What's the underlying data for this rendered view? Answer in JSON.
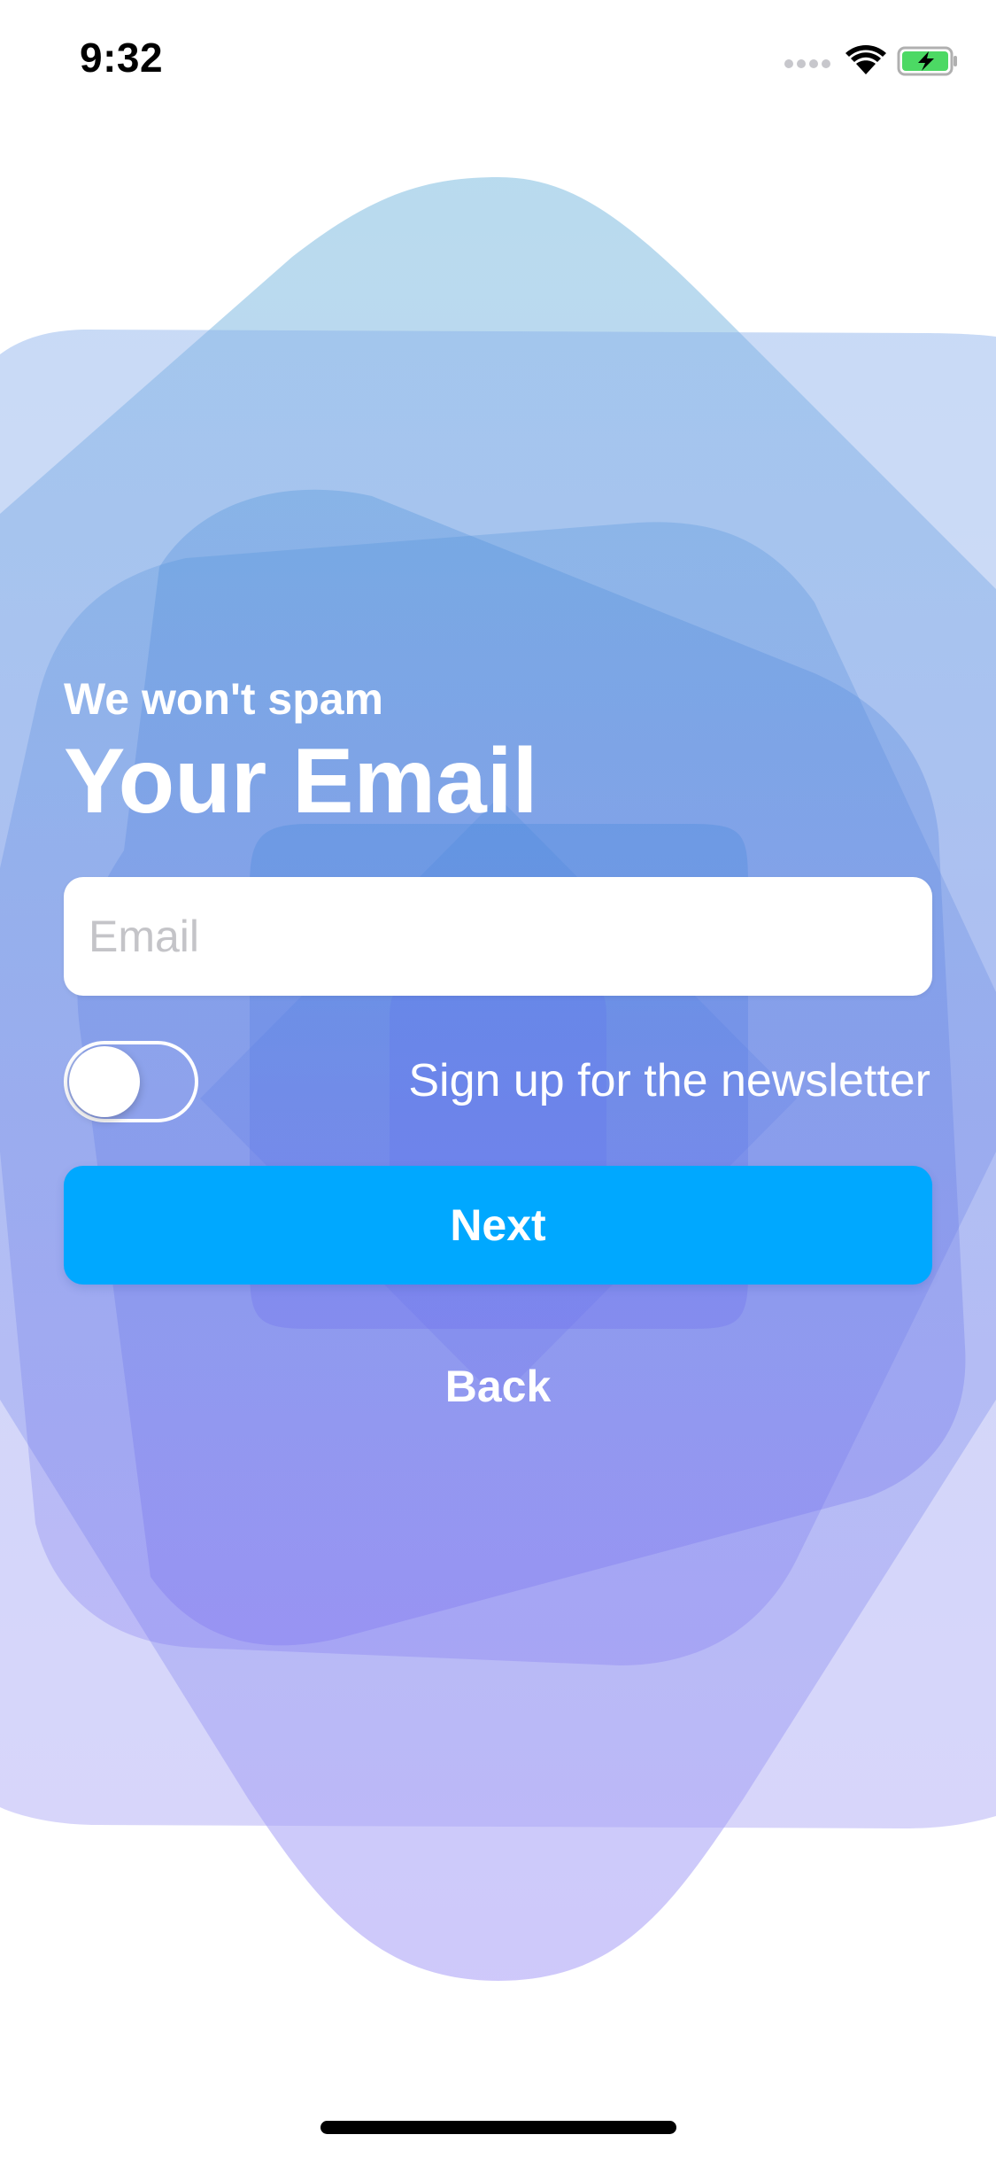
{
  "status_bar": {
    "time": "9:32",
    "icons": [
      "cellular-dots-icon",
      "wifi-icon",
      "battery-charging-icon"
    ]
  },
  "form": {
    "subtitle": "We won't spam",
    "title": "Your Email",
    "email_placeholder": "Email",
    "email_value": "",
    "newsletter_label": "Sign up for the newsletter",
    "newsletter_enabled": false,
    "next_label": "Next",
    "back_label": "Back"
  },
  "colors": {
    "accent": "#00a8ff",
    "shape_top": "#8fc8e6",
    "shape_mid": "#5c8fe8",
    "shape_bottom": "#a89cf8",
    "battery": "#4cd964"
  }
}
